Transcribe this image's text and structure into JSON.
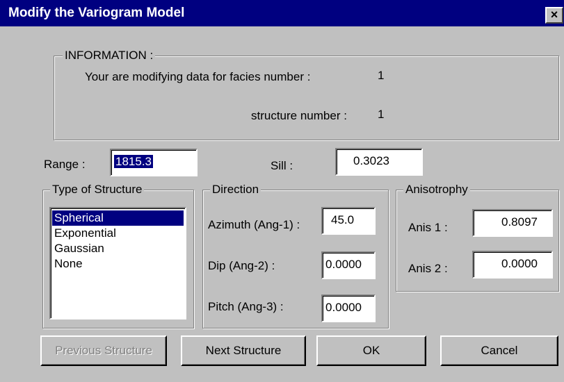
{
  "window": {
    "title": "Modify the Variogram Model",
    "close_label": "×"
  },
  "information": {
    "label": "INFORMATION :",
    "facies_label": "Your are modifying data for facies number :",
    "facies_value": "1",
    "structure_label": "structure number :",
    "structure_value": "1"
  },
  "range": {
    "label": "Range :",
    "value": "1815.3"
  },
  "sill": {
    "label": "Sill :",
    "value": "0.3023"
  },
  "structure_type": {
    "label": "Type of Structure",
    "options": [
      "Spherical",
      "Exponential",
      "Gaussian",
      "None"
    ],
    "selected": "Spherical"
  },
  "direction": {
    "label": "Direction",
    "azimuth_label": "Azimuth (Ang-1) :",
    "azimuth_value": "45.0",
    "dip_label": "Dip (Ang-2) :",
    "dip_value": "0.0000",
    "pitch_label": "Pitch (Ang-3) :",
    "pitch_value": "0.0000"
  },
  "anisotropy": {
    "label": "Anisotrophy",
    "anis1_label": "Anis 1 :",
    "anis1_value": "0.8097",
    "anis2_label": "Anis 2 :",
    "anis2_value": "0.0000"
  },
  "buttons": {
    "previous": "Previous Structure",
    "next": "Next Structure",
    "ok": "OK",
    "cancel": "Cancel"
  },
  "colors": {
    "titlebar": "#000080",
    "dialog_bg": "#c0c0c0",
    "selection": "#000080"
  }
}
